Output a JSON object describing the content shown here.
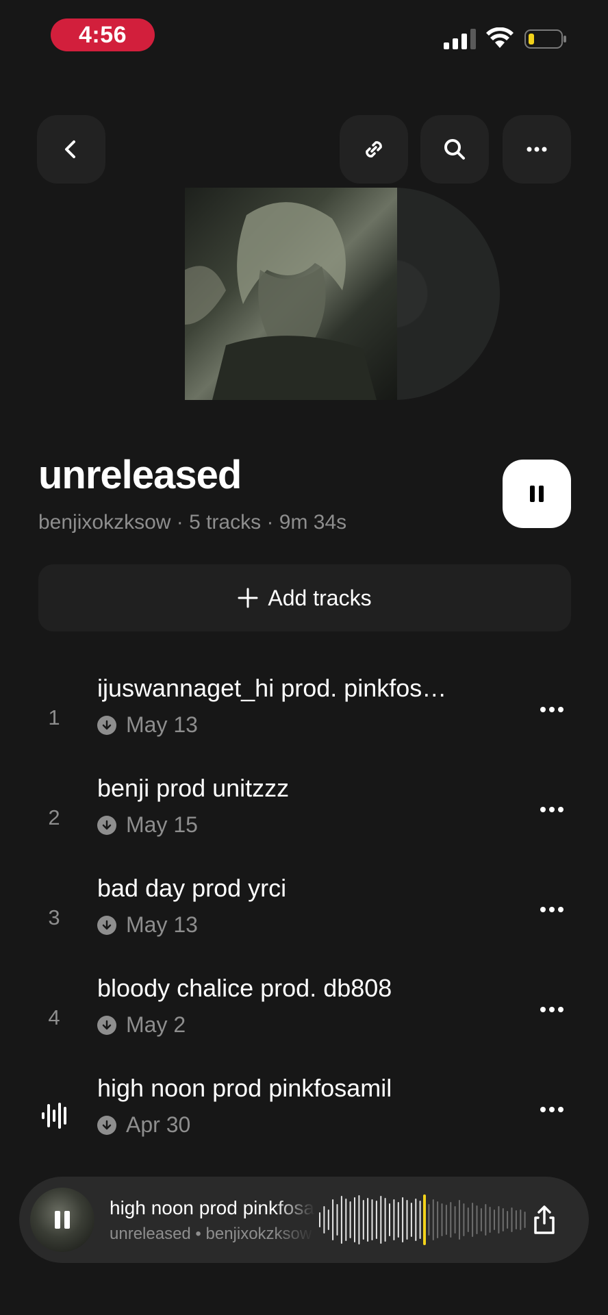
{
  "status_bar": {
    "time": "4:56",
    "icons": [
      "signal-icon",
      "wifi-icon",
      "battery-icon"
    ],
    "battery_color": "#f2d21b"
  },
  "top_bar": {
    "back_icon": "chevron-left-icon",
    "actions": [
      "link-icon",
      "search-icon",
      "more-icon"
    ]
  },
  "playlist": {
    "title": "unreleased",
    "meta": "benjixokzksow · 5 tracks · 9m 34s",
    "play_state": "pause-icon"
  },
  "add_tracks": {
    "label": "Add tracks",
    "icon": "plus-icon"
  },
  "tracks": [
    {
      "number": "1",
      "title": "ijuswannaget_hi prod. pinkfos…",
      "date": "May 13",
      "playing": false
    },
    {
      "number": "2",
      "title": "benji prod unitzzz",
      "date": "May 15",
      "playing": false
    },
    {
      "number": "3",
      "title": "bad day prod yrci",
      "date": "May 13",
      "playing": false
    },
    {
      "number": "4",
      "title": "bloody chalice prod. db808",
      "date": "May 2",
      "playing": false
    },
    {
      "number": "",
      "title": "high noon prod pinkfosamil",
      "date": "Apr 30",
      "playing": true
    }
  ],
  "mini_player": {
    "title": "high noon prod pinkfosamil",
    "subtitle": "unreleased • benjixokzksow",
    "playhead_color": "#f2d21b",
    "share_icon": "share-icon"
  },
  "colors": {
    "background": "#171717",
    "surface": "#222222",
    "secondary_text": "#8e8e8e",
    "time_pill": "#d21f3c"
  }
}
